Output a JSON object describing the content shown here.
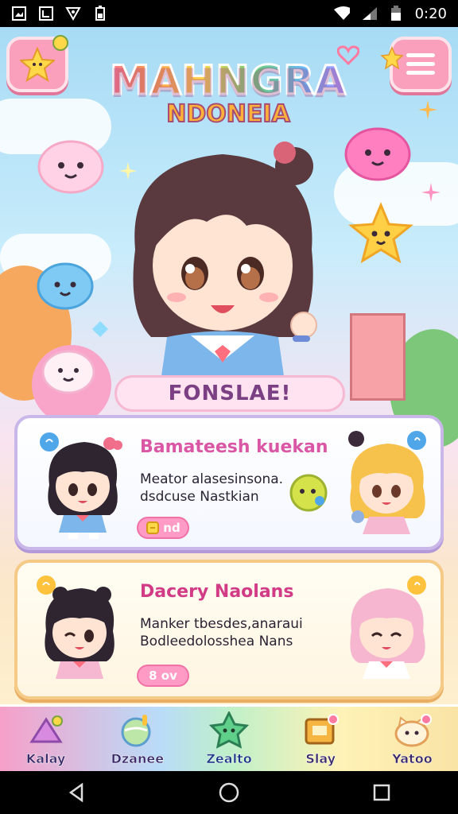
{
  "status_bar": {
    "time": "0:20"
  },
  "header": {
    "logo_line1": "MAHNGRA",
    "logo_line2": "NDONEIA"
  },
  "hero": {
    "banner_text": "FONSLAE!"
  },
  "cards": [
    {
      "title": "Bamateesh kuekan",
      "description": "Meator alasesinsona. dsdcuse Nastkian",
      "pill_label": "nd",
      "pill_icon": "ticket-icon"
    },
    {
      "title": "Dacery Naolans",
      "description": "Manker tbesdes,anaraui Bodleedolosshea Nans",
      "pill_label": "8 ov",
      "pill_icon": ""
    }
  ],
  "bottom_nav": [
    {
      "label": "Kalay",
      "icon": "diamond-flag-icon"
    },
    {
      "label": "Dzanee",
      "icon": "sphere-icon"
    },
    {
      "label": "Zealto",
      "icon": "star-shield-icon"
    },
    {
      "label": "Slay",
      "icon": "chest-icon"
    },
    {
      "label": "Yatoo",
      "icon": "cat-face-icon"
    }
  ],
  "colors": {
    "accent_pink": "#fa9fbc",
    "card_border_purple": "#c9b7ea",
    "card_border_orange": "#f5c986",
    "title_pink": "#d957a4"
  }
}
